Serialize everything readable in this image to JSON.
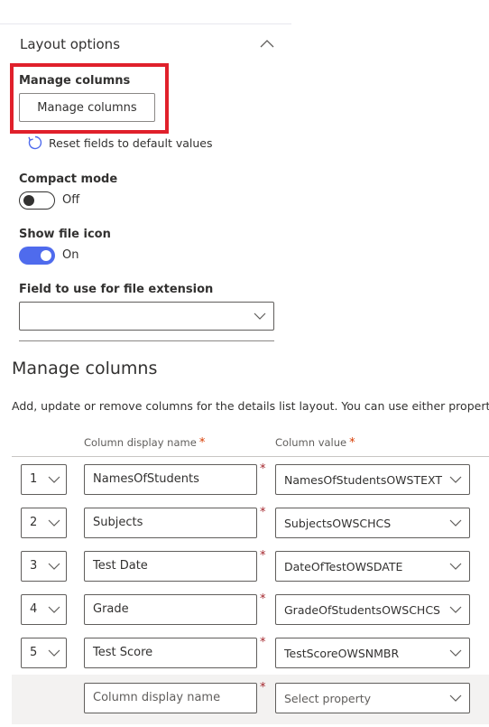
{
  "layout_options": {
    "title": "Layout options",
    "manage_columns_label": "Manage columns",
    "manage_columns_button": "Manage columns",
    "reset_link": "Reset fields to default values",
    "compact_mode": {
      "label": "Compact mode",
      "state": "Off"
    },
    "show_file_icon": {
      "label": "Show file icon",
      "state": "On"
    },
    "file_extension_field": {
      "label": "Field to use for file extension",
      "value": ""
    }
  },
  "manage_columns": {
    "title": "Manage columns",
    "description": "Add, update or remove columns for the details list layout. You can use either property",
    "headers": {
      "display_name": "Column display name",
      "value": "Column value",
      "required_mark": "*"
    },
    "rows": [
      {
        "index": "1",
        "display_name": "NamesOfStudents",
        "value": "NamesOfStudentsOWSTEXT"
      },
      {
        "index": "2",
        "display_name": "Subjects",
        "value": "SubjectsOWSCHCS"
      },
      {
        "index": "3",
        "display_name": "Test Date",
        "value": "DateOfTestOWSDATE"
      },
      {
        "index": "4",
        "display_name": "Grade",
        "value": "GradeOfStudentsOWSCHCS"
      },
      {
        "index": "5",
        "display_name": "Test Score",
        "value": "TestScoreOWSNMBR"
      }
    ],
    "new_row": {
      "display_name_placeholder": "Column display name",
      "value_placeholder": "Select property"
    },
    "required_star": "*"
  },
  "colors": {
    "accent": "#4f6bed",
    "highlight_box": "#e0202b",
    "required": "#a4262c"
  },
  "icons": {
    "collapse": "chevron-up-icon",
    "reset": "refresh-icon",
    "dropdown": "chevron-down-icon"
  }
}
